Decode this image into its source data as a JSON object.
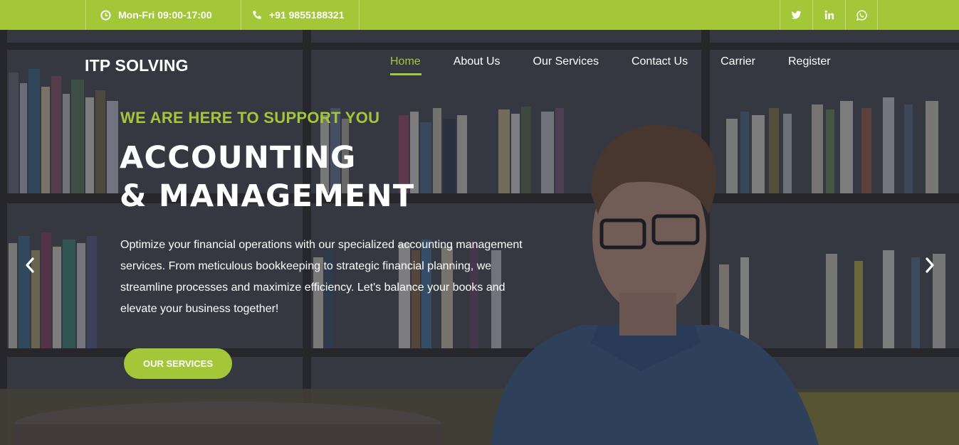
{
  "topbar": {
    "hours": "Mon-Fri 09:00-17:00",
    "phone": "+91 9855188321",
    "social": [
      {
        "icon": "twitter-icon"
      },
      {
        "icon": "linkedin-icon"
      },
      {
        "icon": "whatsapp-icon"
      }
    ]
  },
  "brand": {
    "logo": "ITP SOLVING"
  },
  "nav": {
    "items": [
      {
        "label": "Home",
        "active": true
      },
      {
        "label": "About Us"
      },
      {
        "label": "Our Services"
      },
      {
        "label": "Contact Us"
      },
      {
        "label": "Carrier"
      },
      {
        "label": "Register"
      }
    ]
  },
  "hero": {
    "kicker": "WE ARE HERE TO SUPPORT YOU",
    "headline_line1": "ACCOUNTING",
    "headline_line2": "& MANAGEMENT",
    "description": "Optimize your financial operations with our specialized accounting management services. From meticulous bookkeeping to strategic financial planning, we streamline processes and maximize efficiency. Let's balance your books and elevate your business together!",
    "cta_label": "OUR SERVICES",
    "prev_icon": "chevron-left-icon",
    "next_icon": "chevron-right-icon"
  },
  "colors": {
    "accent": "#a4c639",
    "text": "#ffffff"
  }
}
